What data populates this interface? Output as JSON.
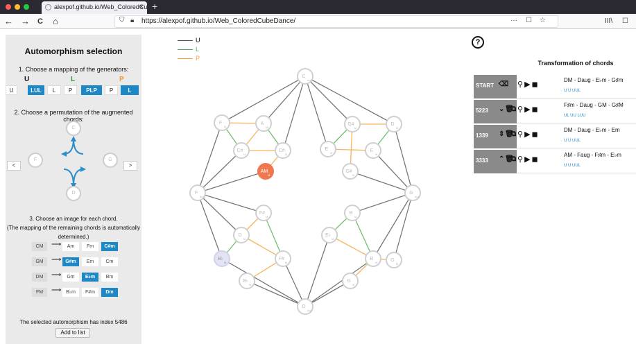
{
  "browser": {
    "tab_title": "alexpof.github.io/Web_ColoredCubeDance/",
    "tab_close": "×",
    "new_tab": "+",
    "url": "https://alexpof.github.io/Web_ColoredCubeDance/",
    "nav": {
      "back": "←",
      "forward": "→",
      "reload": "C",
      "home": "⌂",
      "more": "···",
      "pocket": "☐",
      "star": "☆",
      "library": "III\\",
      "sidebar": "☐"
    },
    "traffic_colors": [
      "#ff5f57",
      "#febc2e",
      "#28c840"
    ]
  },
  "left": {
    "title": "Automorphism selection",
    "step1": "1. Choose a mapping of the generators:",
    "generators": [
      {
        "label": "U",
        "color": "#111111"
      },
      {
        "label": "L",
        "color": "#2e9b2e"
      },
      {
        "label": "P",
        "color": "#f39c2b"
      }
    ],
    "gen_buttons": [
      {
        "label": "U",
        "selected": false
      },
      {
        "label": "LUL",
        "selected": true
      },
      {
        "label": "L",
        "selected": false
      },
      {
        "label": "P",
        "selected": false
      },
      {
        "label": "PLP",
        "selected": true
      },
      {
        "label": "P",
        "selected": false
      },
      {
        "label": "L",
        "selected": true
      }
    ],
    "step2": "2. Choose a permutation of the augmented chords:",
    "aug_nodes": {
      "top": "Caug",
      "left": "Faug",
      "right": "Gaug",
      "bottom": "Daug"
    },
    "aug_node_labels": {
      "top": "C",
      "left": "F",
      "right": "G",
      "bottom": "D",
      "sub": "aug"
    },
    "prev": "<",
    "next": ">",
    "step3_line1": "3. Choose an image for each chord.",
    "step3_line2": "(The mapping of the remaining chords is automatically",
    "step3_line3": "determined.)",
    "arrow": "⟶",
    "rows": [
      {
        "src": "CM",
        "opts": [
          {
            "t": "Am",
            "s": false
          },
          {
            "t": "Fm",
            "s": false
          },
          {
            "t": "C#m",
            "s": true
          }
        ]
      },
      {
        "src": "GM",
        "opts": [
          {
            "t": "G#m",
            "s": true
          },
          {
            "t": "Em",
            "s": false
          },
          {
            "t": "Cm",
            "s": false
          }
        ]
      },
      {
        "src": "DM",
        "opts": [
          {
            "t": "Gm",
            "s": false
          },
          {
            "t": "E♭m",
            "s": true
          },
          {
            "t": "Bm",
            "s": false
          }
        ]
      },
      {
        "src": "FM",
        "opts": [
          {
            "t": "B♭m",
            "s": false
          },
          {
            "t": "F#m",
            "s": false
          },
          {
            "t": "Dm",
            "s": true
          }
        ]
      }
    ],
    "index_text": "The selected automorphism has index 5486",
    "add_button": "Add to list"
  },
  "legend": [
    {
      "label": "U",
      "color": "#555555"
    },
    {
      "label": "L",
      "color": "#4caf50"
    },
    {
      "label": "P",
      "color": "#f7a23c"
    }
  ],
  "graph": {
    "highlight_color": "#f07850",
    "highlight_label": "AM",
    "blue_node_label": "B♭",
    "nodes": {
      "top": "C",
      "left": "F",
      "right": "G",
      "bottom": "D",
      "aug": "aug",
      "m": "M",
      "mm": "m",
      "labels_tl": [
        "F",
        "F",
        "A",
        "C#",
        "C#"
      ],
      "labels_tr": [
        "D",
        "G#",
        "C",
        "E",
        "E",
        "G#"
      ],
      "labels_bl": [
        "F#",
        "D",
        "F#",
        "B♭"
      ],
      "labels_br": [
        "B",
        "E♭",
        "B",
        "G",
        "G"
      ]
    }
  },
  "right": {
    "help": "?",
    "title": "Transformation of chords",
    "rows": [
      {
        "id": "START",
        "chords": "DM - Daug - E♭m - G♯m",
        "ops": "U      U        UUL"
      },
      {
        "id": "5223",
        "chords": "F♯m - Daug - GM - G♯M",
        "ops": "UL      UU      LUU"
      },
      {
        "id": "1339",
        "chords": "DM - Daug - E♭m - Em",
        "ops": "U      U        UUL"
      },
      {
        "id": "3333",
        "chords": "AM - Faug - F♯m - E♭m",
        "ops": "U      U      UUL"
      }
    ],
    "icons": {
      "search": "🔍",
      "play": "⬤",
      "stop": "⬤",
      "trash": "🗑",
      "copy": "⧉",
      "down": "⌄",
      "up": "⌃",
      "clear": "⌫"
    }
  }
}
